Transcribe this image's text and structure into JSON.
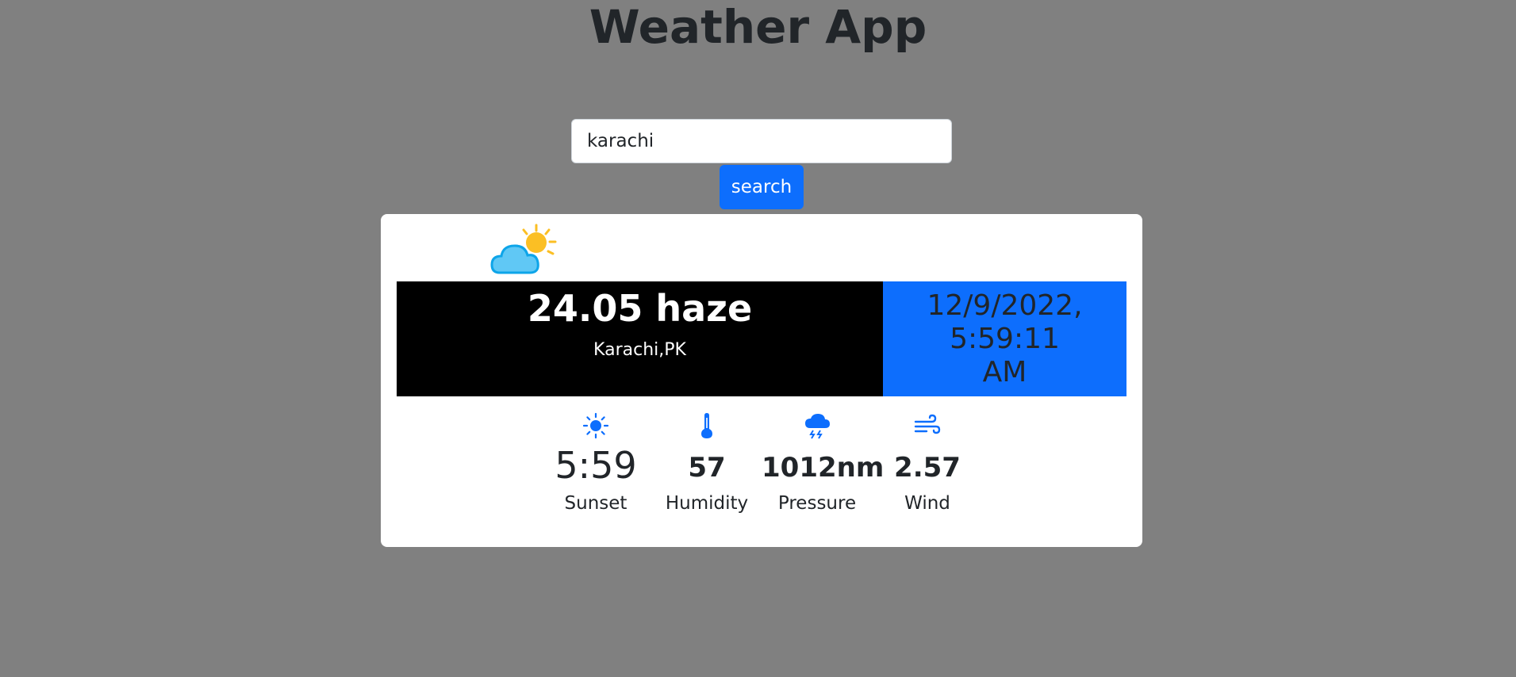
{
  "header": {
    "title": "Weather App"
  },
  "search": {
    "value": "karachi",
    "button_label": "search"
  },
  "weather": {
    "icon": "partly-cloudy-icon",
    "temp_summary": "24.05 haze",
    "location": "Karachi,PK",
    "datetime": "12/9/2022, 5:59:11 AM"
  },
  "stats": [
    {
      "icon": "sun-icon",
      "value": "5:59",
      "label": "Sunset"
    },
    {
      "icon": "thermometer-icon",
      "value": "57",
      "label": "Humidity"
    },
    {
      "icon": "storm-cloud-icon",
      "value": "1012nm",
      "label": "Pressure"
    },
    {
      "icon": "wind-icon",
      "value": "2.57",
      "label": "Wind"
    }
  ],
  "colors": {
    "background": "#808080",
    "accent": "#0d6efd",
    "card": "#ffffff",
    "temp_panel": "#000000",
    "text": "#212529"
  }
}
